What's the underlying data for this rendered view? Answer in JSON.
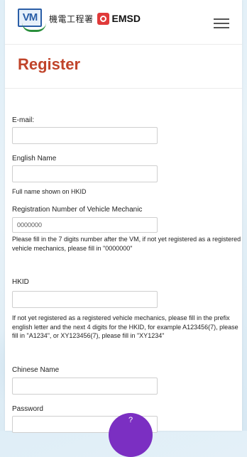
{
  "header": {
    "dept_cn": "機電工程署",
    "dept_en": "EMSD",
    "logo_text": "VM",
    "menu_icon": "hamburger-menu-icon"
  },
  "page": {
    "title": "Register"
  },
  "form": {
    "email_label": "E-mail:",
    "english_name_label": "English Name",
    "english_name_hint": "Full name shown on HKID",
    "reg_number_label": "Registration Number of Vehicle Mechanic",
    "reg_number_placeholder": "0000000",
    "reg_number_hint": "Please fill in the 7 digits number after the VM, if not yet registered as a registered vehicle mechanics, please fill in \"0000000\"",
    "hkid_label": "HKID",
    "hkid_hint": "If not yet registered as a registered vehicle mechanics, please fill in the prefix english letter and the next 4 digits for the HKID, for example A123456(7), please fill in \"A1234\", or XY123456(7), please fill in \"XY1234\"",
    "chinese_name_label": "Chinese Name",
    "password_label": "Password"
  },
  "colors": {
    "title": "#c0442a",
    "fab": "#7b2fc2",
    "logo_blue": "#2a5ea7",
    "emsd_red": "#e03a3a"
  }
}
